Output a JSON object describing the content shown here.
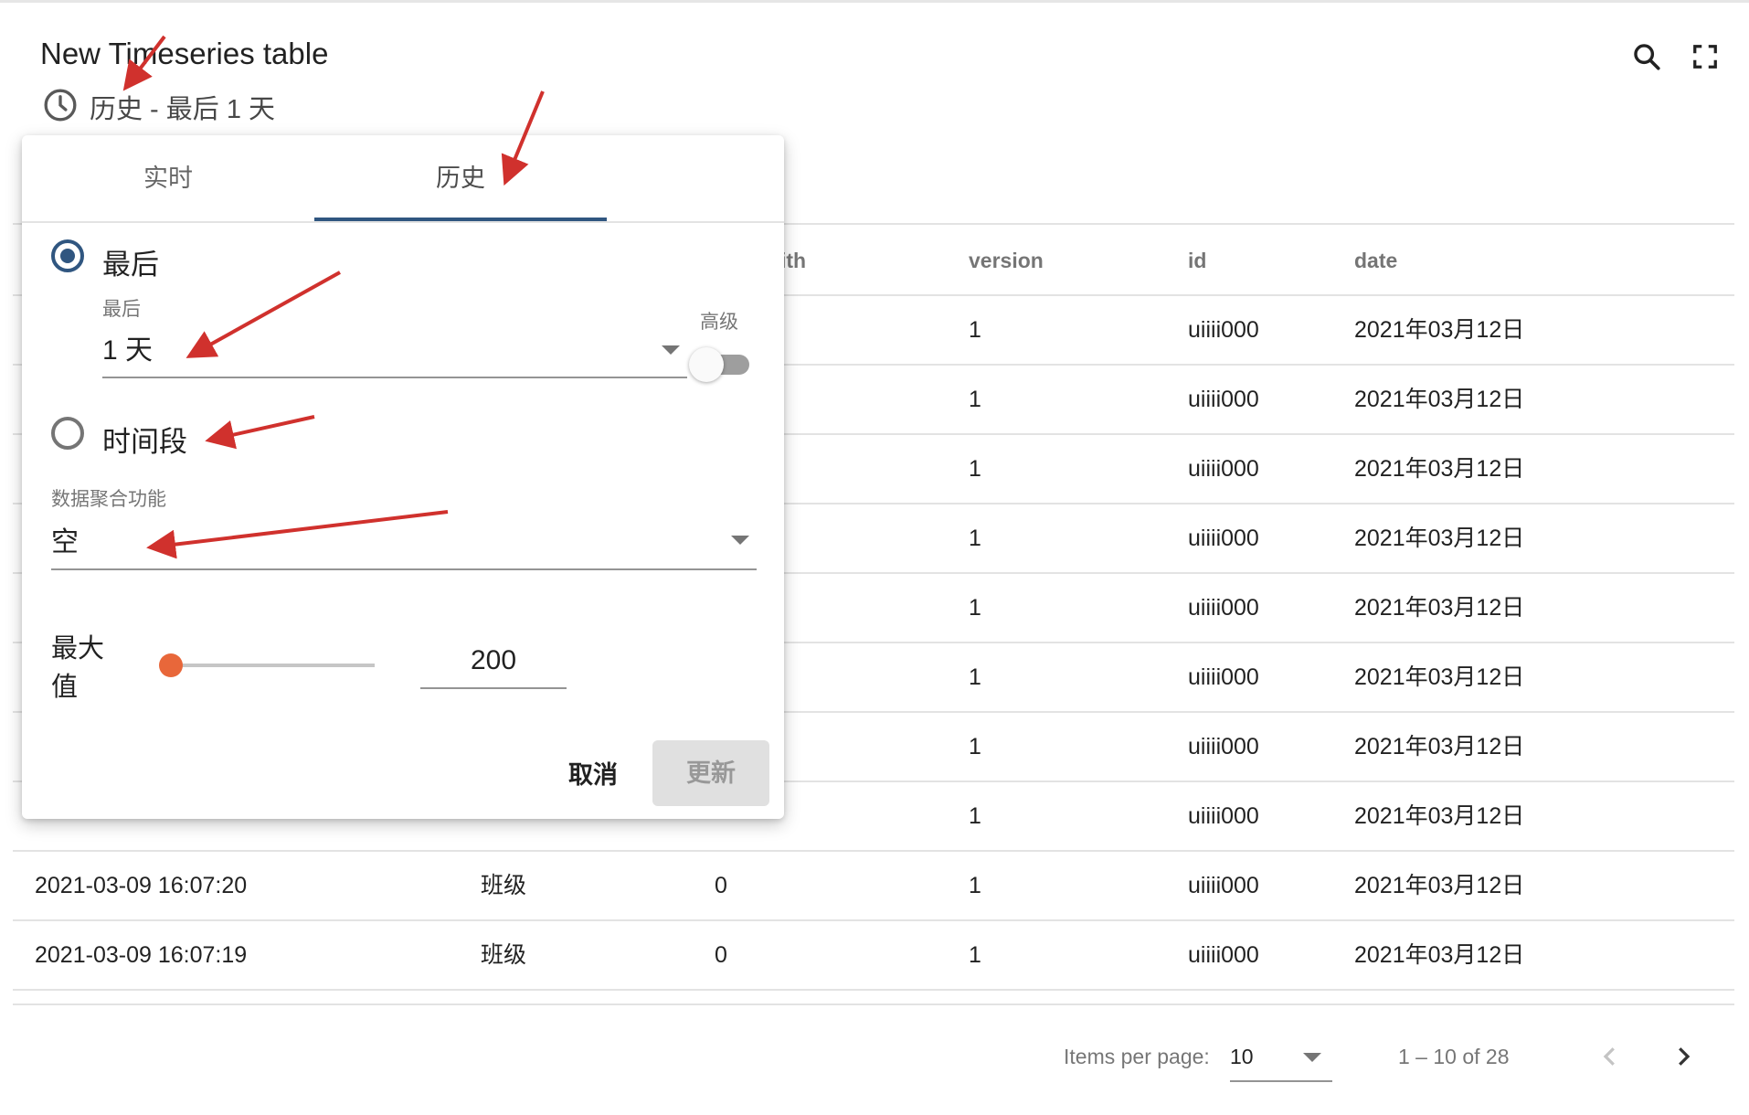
{
  "header": {
    "title": "New Timeseries table",
    "timewindow_text": "历史 - 最后 1 天",
    "icons": [
      "clock-icon",
      "search-icon",
      "fullscreen-icon"
    ]
  },
  "table": {
    "columns": [
      "ith",
      "version",
      "id",
      "date"
    ],
    "rows": [
      {
        "ts": "",
        "class": "",
        "n": "",
        "version": "1",
        "id": "uiiii000",
        "date": "2021年03月12日"
      },
      {
        "ts": "",
        "class": "",
        "n": "",
        "version": "1",
        "id": "uiiii000",
        "date": "2021年03月12日"
      },
      {
        "ts": "",
        "class": "",
        "n": "",
        "version": "1",
        "id": "uiiii000",
        "date": "2021年03月12日"
      },
      {
        "ts": "",
        "class": "",
        "n": "",
        "version": "1",
        "id": "uiiii000",
        "date": "2021年03月12日"
      },
      {
        "ts": "",
        "class": "",
        "n": "",
        "version": "1",
        "id": "uiiii000",
        "date": "2021年03月12日"
      },
      {
        "ts": "",
        "class": "",
        "n": "",
        "version": "1",
        "id": "uiiii000",
        "date": "2021年03月12日"
      },
      {
        "ts": "",
        "class": "",
        "n": "",
        "version": "1",
        "id": "uiiii000",
        "date": "2021年03月12日"
      },
      {
        "ts": "",
        "class": "",
        "n": "",
        "version": "1",
        "id": "uiiii000",
        "date": "2021年03月12日"
      },
      {
        "ts": "2021-03-09 16:07:20",
        "class": "班级",
        "n": "0",
        "version": "1",
        "id": "uiiii000",
        "date": "2021年03月12日"
      },
      {
        "ts": "2021-03-09 16:07:19",
        "class": "班级",
        "n": "0",
        "version": "1",
        "id": "uiiii000",
        "date": "2021年03月12日"
      }
    ]
  },
  "paginator": {
    "items_per_page_label": "Items per page:",
    "items_per_page_value": "10",
    "range_label": "1 – 10 of 28"
  },
  "timewindow_panel": {
    "tabs": [
      "实时",
      "历史"
    ],
    "active_tab": "历史",
    "last_option_label": "最后",
    "last_field_label": "最后",
    "last_field_value": "1 天",
    "advanced_label": "高级",
    "advanced_enabled": false,
    "range_option_label": "时间段",
    "aggregation_label": "数据聚合功能",
    "aggregation_value": "空",
    "max_values_label_line1": "最大",
    "max_values_label_line2": "值",
    "max_values": "200",
    "cancel_label": "取消",
    "update_label": "更新"
  },
  "colors": {
    "accent": "#305680",
    "slider_thumb": "#e8673a",
    "annotation_arrow": "#d0312d"
  }
}
